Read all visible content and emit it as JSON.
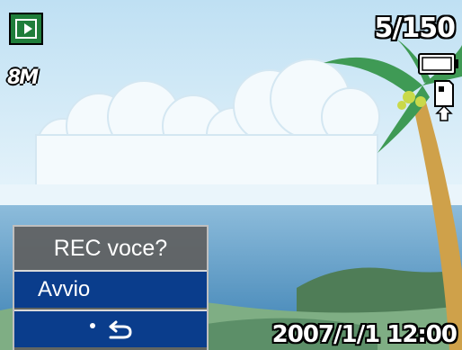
{
  "osd": {
    "shot_counter": "5/150",
    "datetime": "2007/1/1 12:00",
    "image_size_label": "8M"
  },
  "menu": {
    "title": "REC voce?",
    "items": [
      {
        "label": "Avvio",
        "selected": true
      },
      {
        "label": "",
        "icon": "back-arrow-icon"
      }
    ]
  },
  "icons": [
    "playback-mode-icon",
    "image-size-icon",
    "battery-icon",
    "memory-card-icon"
  ],
  "colors": {
    "sky": "#d8ecf7",
    "sea": "#5f9cc6",
    "grass": "#5c8f68",
    "menu_bg": "#5f5f5f",
    "menu_selected": "#0a3d8c",
    "play_icon": "#1f7d3a"
  }
}
